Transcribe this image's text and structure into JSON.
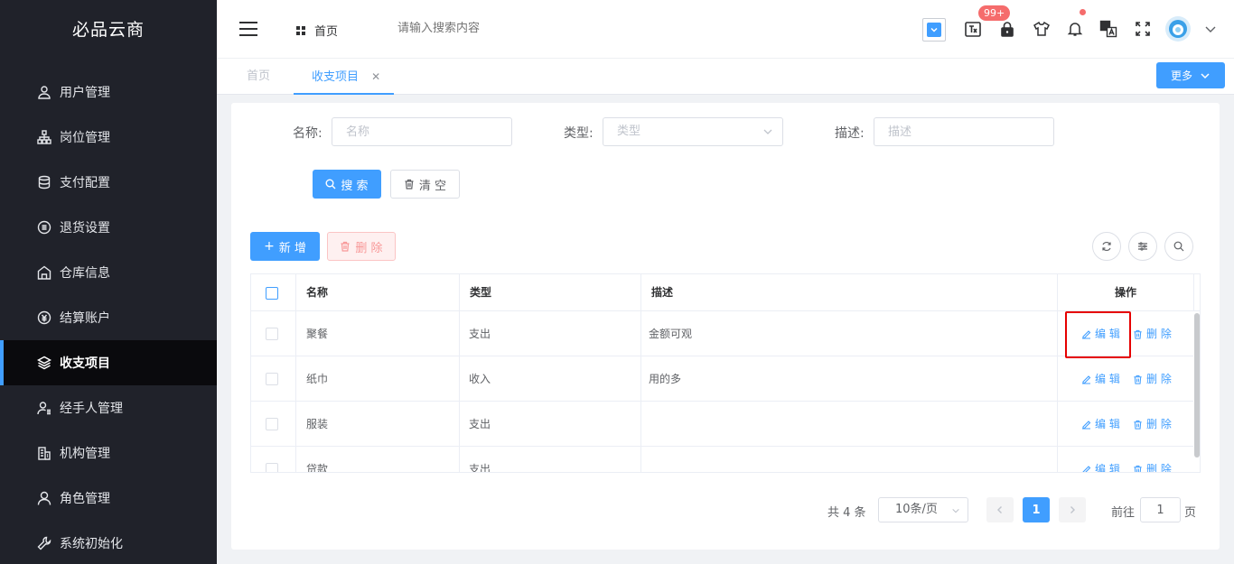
{
  "app": {
    "title": "必品云商"
  },
  "sidebar": {
    "items": [
      {
        "label": "用户管理",
        "icon": "user-icon"
      },
      {
        "label": "岗位管理",
        "icon": "org-chart-icon"
      },
      {
        "label": "支付配置",
        "icon": "database-icon"
      },
      {
        "label": "退货设置",
        "icon": "circle-list-icon"
      },
      {
        "label": "仓库信息",
        "icon": "warehouse-icon"
      },
      {
        "label": "结算账户",
        "icon": "money-icon"
      },
      {
        "label": "收支项目",
        "icon": "layers-icon",
        "active": true
      },
      {
        "label": "经手人管理",
        "icon": "user-manager-icon"
      },
      {
        "label": "机构管理",
        "icon": "building-icon"
      },
      {
        "label": "角色管理",
        "icon": "role-icon"
      },
      {
        "label": "系统初始化",
        "icon": "wrench-icon"
      }
    ]
  },
  "header": {
    "home": "首页",
    "search_placeholder": "请输入搜索内容",
    "badge": "99+"
  },
  "tabs": {
    "items": [
      "首页",
      "收支项目"
    ],
    "more": "更多"
  },
  "filters": {
    "name_label": "名称:",
    "name_placeholder": "名称",
    "type_label": "类型:",
    "type_placeholder": "类型",
    "desc_label": "描述:",
    "desc_placeholder": "描述",
    "search_btn": "搜 索",
    "clear_btn": "清 空"
  },
  "toolbar": {
    "add_btn": "新 增",
    "delete_btn": "删 除"
  },
  "table": {
    "headers": [
      "名称",
      "类型",
      "描述",
      "操作"
    ],
    "rows": [
      {
        "name": "聚餐",
        "type": "支出",
        "desc": "金额可观"
      },
      {
        "name": "纸巾",
        "type": "收入",
        "desc": "用的多"
      },
      {
        "name": "服装",
        "type": "支出",
        "desc": ""
      },
      {
        "name": "贷款",
        "type": "支出",
        "desc": ""
      }
    ],
    "edit_label": "编 辑",
    "delete_label": "删 除"
  },
  "pagination": {
    "total": "共 4 条",
    "page_size": "10条/页",
    "current": "1",
    "goto_label": "前往",
    "goto_value": "1",
    "page_suffix": "页"
  },
  "colors": {
    "accent": "#409eff",
    "sidebar_bg": "#20222a",
    "danger": "#f56c6c",
    "highlight": "#e60000"
  }
}
